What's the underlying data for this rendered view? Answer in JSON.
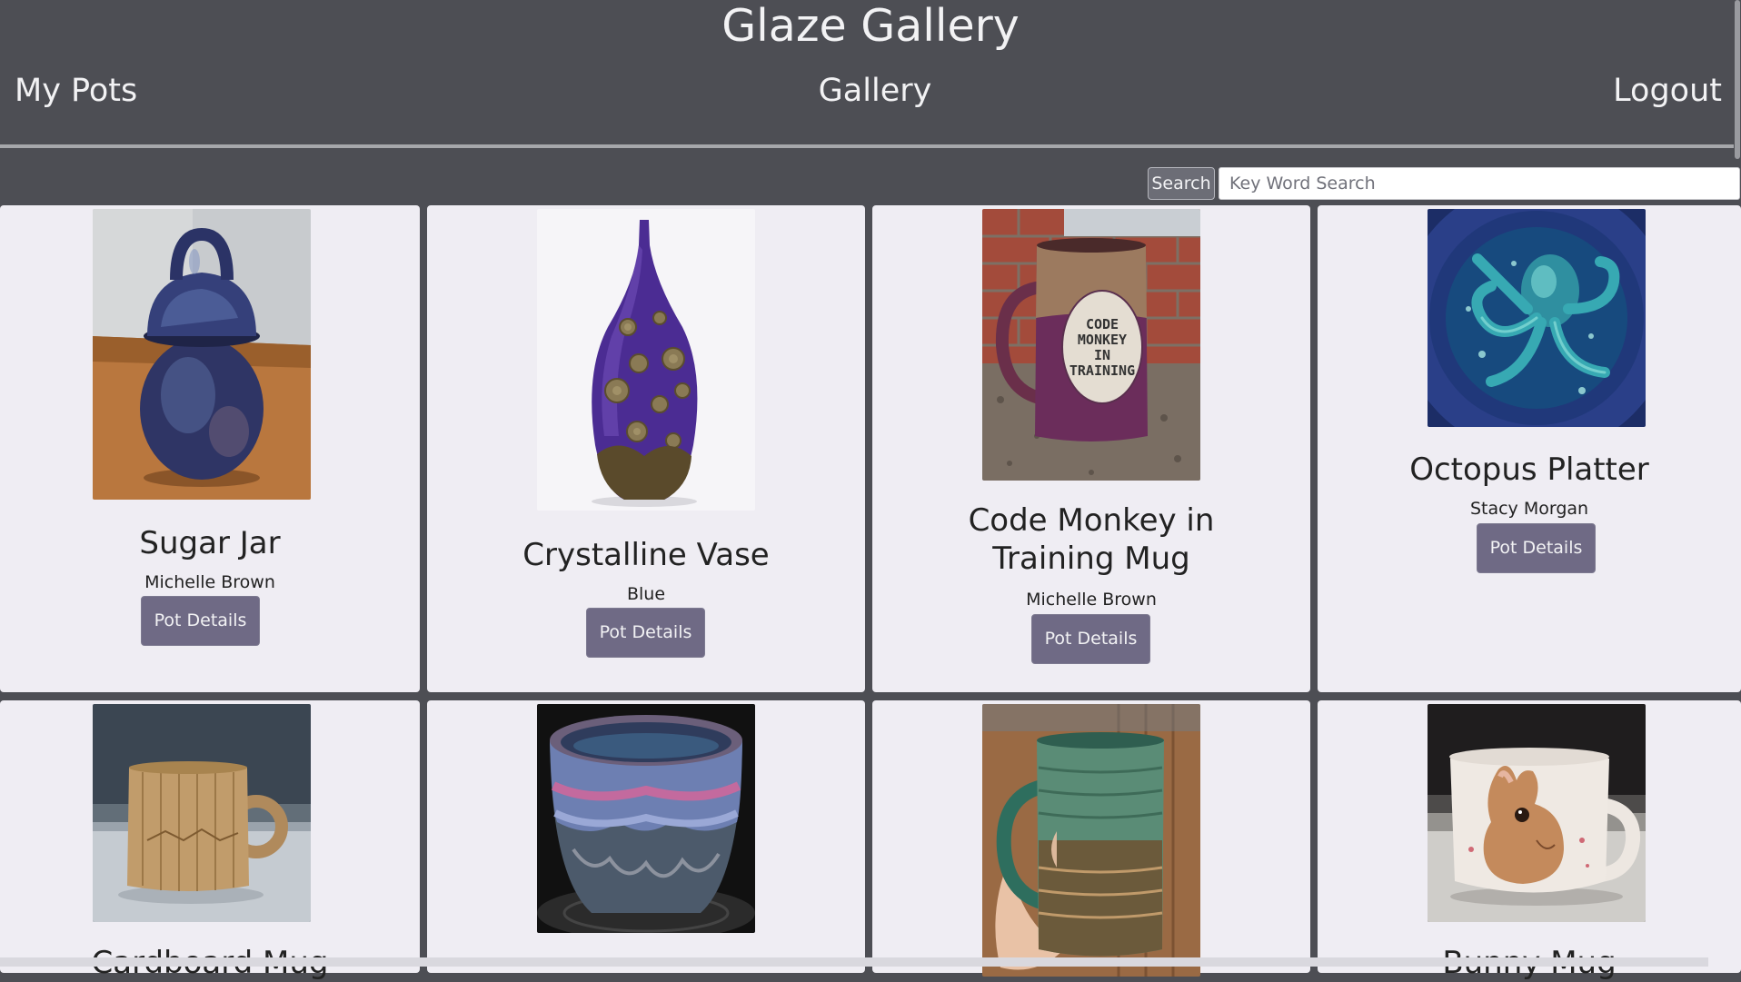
{
  "header": {
    "title": "Glaze Gallery",
    "nav": {
      "my_pots": "My Pots",
      "gallery": "Gallery",
      "logout": "Logout"
    }
  },
  "search": {
    "button_label": "Search",
    "placeholder": "Key Word Search"
  },
  "pots": [
    {
      "name": "Sugar Jar",
      "subtitle": "Michelle Brown",
      "button": "Pot Details"
    },
    {
      "name": "Crystalline Vase",
      "subtitle": "Blue",
      "button": "Pot Details"
    },
    {
      "name": "Code Monkey in Training Mug",
      "subtitle": "Michelle Brown",
      "button": "Pot Details",
      "image_text": [
        "CODE",
        "MONKEY",
        "IN",
        "TRAINING"
      ]
    },
    {
      "name": "Octopus Platter",
      "subtitle": "Stacy Morgan",
      "button": "Pot Details"
    },
    {
      "name": "Cardboard Mug"
    },
    {},
    {},
    {
      "name": "Bunny Mug"
    }
  ]
}
